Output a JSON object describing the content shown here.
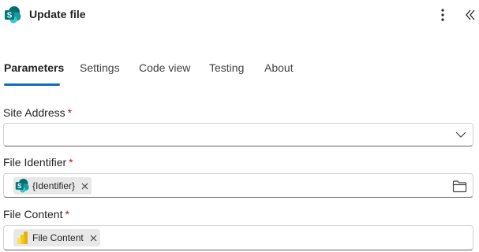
{
  "header": {
    "title": "Update file",
    "icon": "sharepoint-icon",
    "more_icon": "more-vertical-icon",
    "collapse_icon": "double-chevron-left-icon"
  },
  "tabs": [
    {
      "label": "Parameters",
      "active": true
    },
    {
      "label": "Settings",
      "active": false
    },
    {
      "label": "Code view",
      "active": false
    },
    {
      "label": "Testing",
      "active": false
    },
    {
      "label": "About",
      "active": false
    }
  ],
  "fields": {
    "site_address": {
      "label": "Site Address",
      "required_mark": "*",
      "value": "",
      "control": "dropdown"
    },
    "file_identifier": {
      "label": "File Identifier",
      "required_mark": "*",
      "token": "{Identifier}",
      "token_icon": "sharepoint-icon",
      "action_icon": "folder-icon"
    },
    "file_content": {
      "label": "File Content",
      "required_mark": "*",
      "token": "File Content",
      "token_icon": "power-bi-icon"
    }
  },
  "colors": {
    "accent": "#0f6cbd",
    "required": "#c50f1f",
    "token_bg": "#e8e8e8"
  }
}
